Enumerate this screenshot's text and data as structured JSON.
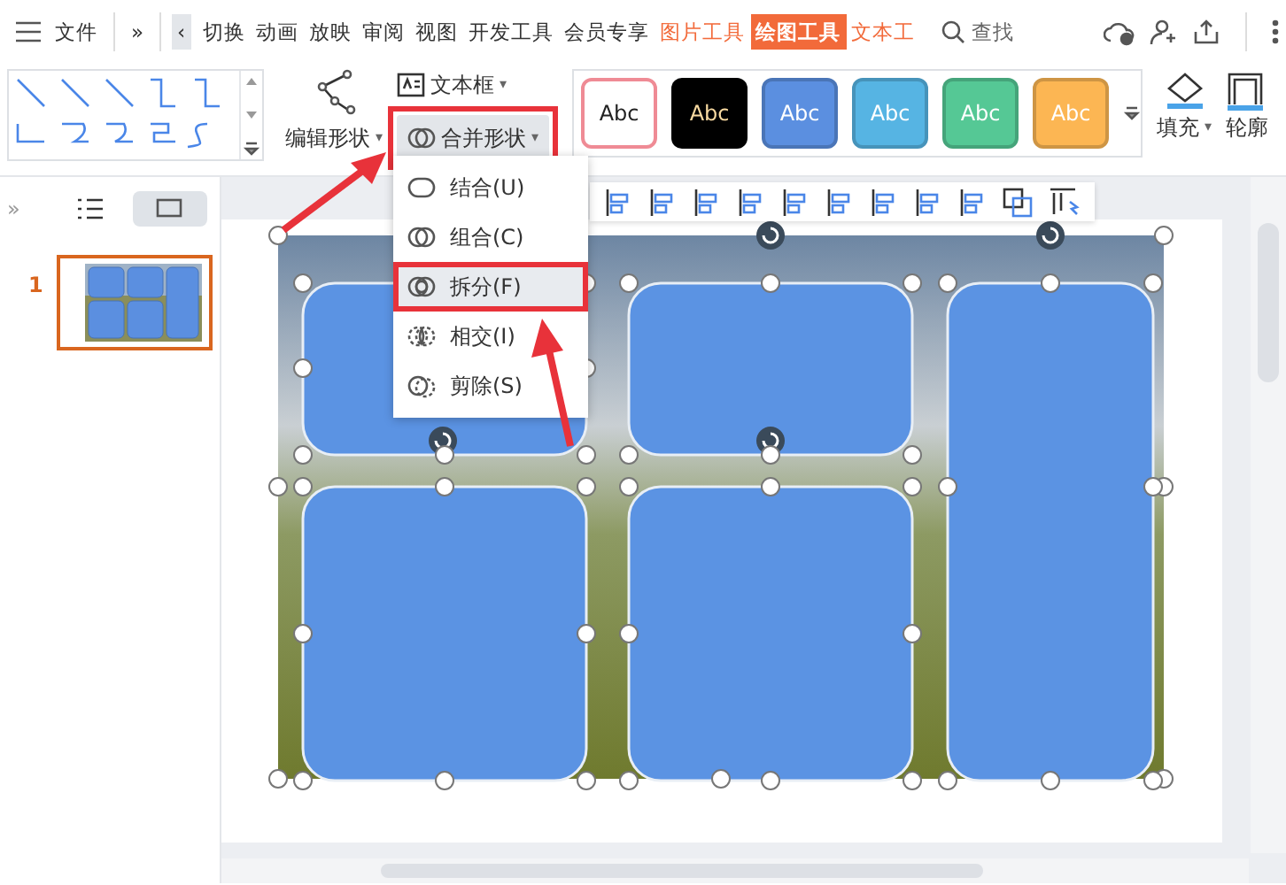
{
  "menu_bar": {
    "file": "文件",
    "more": "»",
    "back": "‹",
    "search": "查找",
    "tabs": [
      {
        "label": "切换",
        "kind": "normal",
        "selected": false
      },
      {
        "label": "动画",
        "kind": "normal",
        "selected": false
      },
      {
        "label": "放映",
        "kind": "normal",
        "selected": false
      },
      {
        "label": "审阅",
        "kind": "normal",
        "selected": false
      },
      {
        "label": "视图",
        "kind": "normal",
        "selected": false
      },
      {
        "label": "开发工具",
        "kind": "normal",
        "selected": false
      },
      {
        "label": "会员专享",
        "kind": "normal",
        "selected": false
      },
      {
        "label": "图片工具",
        "kind": "context",
        "selected": false
      },
      {
        "label": "绘图工具",
        "kind": "context",
        "selected": true
      },
      {
        "label": "文本工",
        "kind": "context",
        "selected": false
      }
    ]
  },
  "ribbon": {
    "edit_shape": {
      "label": "编辑形状",
      "caret": "▾"
    },
    "text_box": {
      "label": "文本框",
      "caret": "▾"
    },
    "merge_shape": {
      "label": "合并形状",
      "caret": "▾",
      "highlighted": true,
      "expanded": true
    },
    "styles": [
      {
        "label": "Abc",
        "color": "#ffffff"
      },
      {
        "label": "Abc",
        "color": "#000000"
      },
      {
        "label": "Abc",
        "color": "#5b8fe0"
      },
      {
        "label": "Abc",
        "color": "#56b4e3"
      },
      {
        "label": "Abc",
        "color": "#55c895"
      },
      {
        "label": "Abc",
        "color": "#fcb653"
      }
    ],
    "fill": {
      "label": "填充",
      "caret": "▾"
    },
    "outline": "轮廓"
  },
  "merge_menu": [
    {
      "label": "结合(U)",
      "kind": "union",
      "selected": false
    },
    {
      "label": "组合(C)",
      "kind": "combine",
      "selected": false
    },
    {
      "label": "拆分(F)",
      "kind": "fragment",
      "selected": true
    },
    {
      "label": "相交(I)",
      "kind": "intersect",
      "selected": false
    },
    {
      "label": "剪除(S)",
      "kind": "subtract",
      "selected": false
    }
  ],
  "slide_panel": {
    "more": "»",
    "slides": [
      {
        "number": "1",
        "selected": true
      }
    ]
  }
}
